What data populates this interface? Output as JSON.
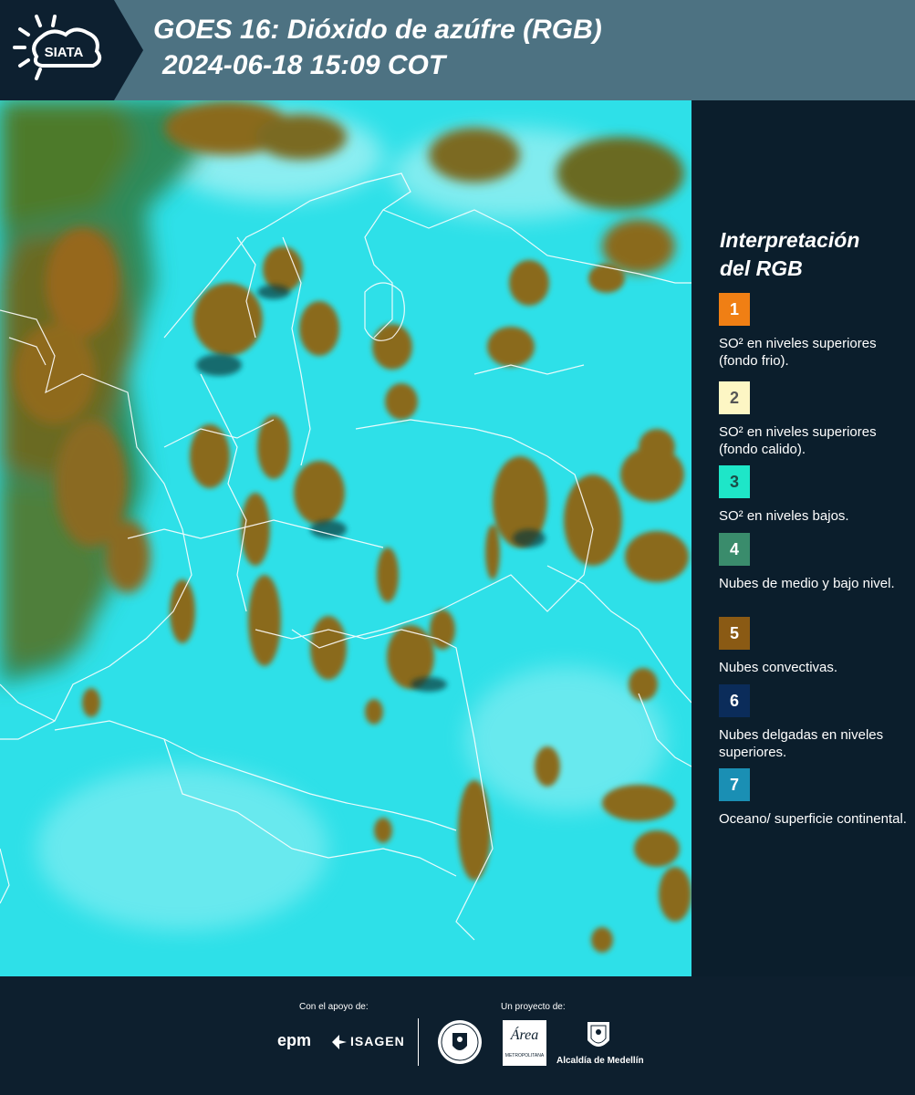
{
  "header": {
    "logo_text": "SIATA",
    "title_line1": "GOES 16: Dióxido de azúfre (RGB)",
    "title_line2": "2024-06-18 15:09 COT"
  },
  "legend": {
    "title_line1": "Interpretación",
    "title_line2": "del RGB",
    "items": [
      {
        "num": "1",
        "color": "#f07f14",
        "num_color": "#ffffff",
        "text": "SO² en niveles superiores (fondo frio)."
      },
      {
        "num": "2",
        "color": "#fdf6c4",
        "num_color": "#555555",
        "text": "SO² en niveles superiores (fondo calido)."
      },
      {
        "num": "3",
        "color": "#1ee6c8",
        "num_color": "#1b4d47",
        "text": "SO² en niveles bajos."
      },
      {
        "num": "4",
        "color": "#3a8c6c",
        "num_color": "#ffffff",
        "text": "Nubes de medio y bajo nivel."
      },
      {
        "num": "5",
        "color": "#8a5a14",
        "num_color": "#ffffff",
        "text": "Nubes convectivas."
      },
      {
        "num": "6",
        "color": "#0b2c5a",
        "num_color": "#ffffff",
        "text": "Nubes delgadas en niveles superiores."
      },
      {
        "num": "7",
        "color": "#1a8fb4",
        "num_color": "#ffffff",
        "text": "Oceano/ superficie continental."
      }
    ]
  },
  "footer": {
    "support_label": "Con el apoyo de:",
    "project_label": "Un proyecto de:",
    "epm": "epm",
    "isagen": "ISAGEN",
    "area_metropolitana": "Área",
    "area_sub": "METROPOLITANA",
    "alcaldia": "Alcaldía de Medellín"
  },
  "colors": {
    "cyan_background": "#2ee0e8",
    "convective": "#8a6a1c",
    "header": "#4d7282",
    "panel": "#0d1f2e"
  }
}
